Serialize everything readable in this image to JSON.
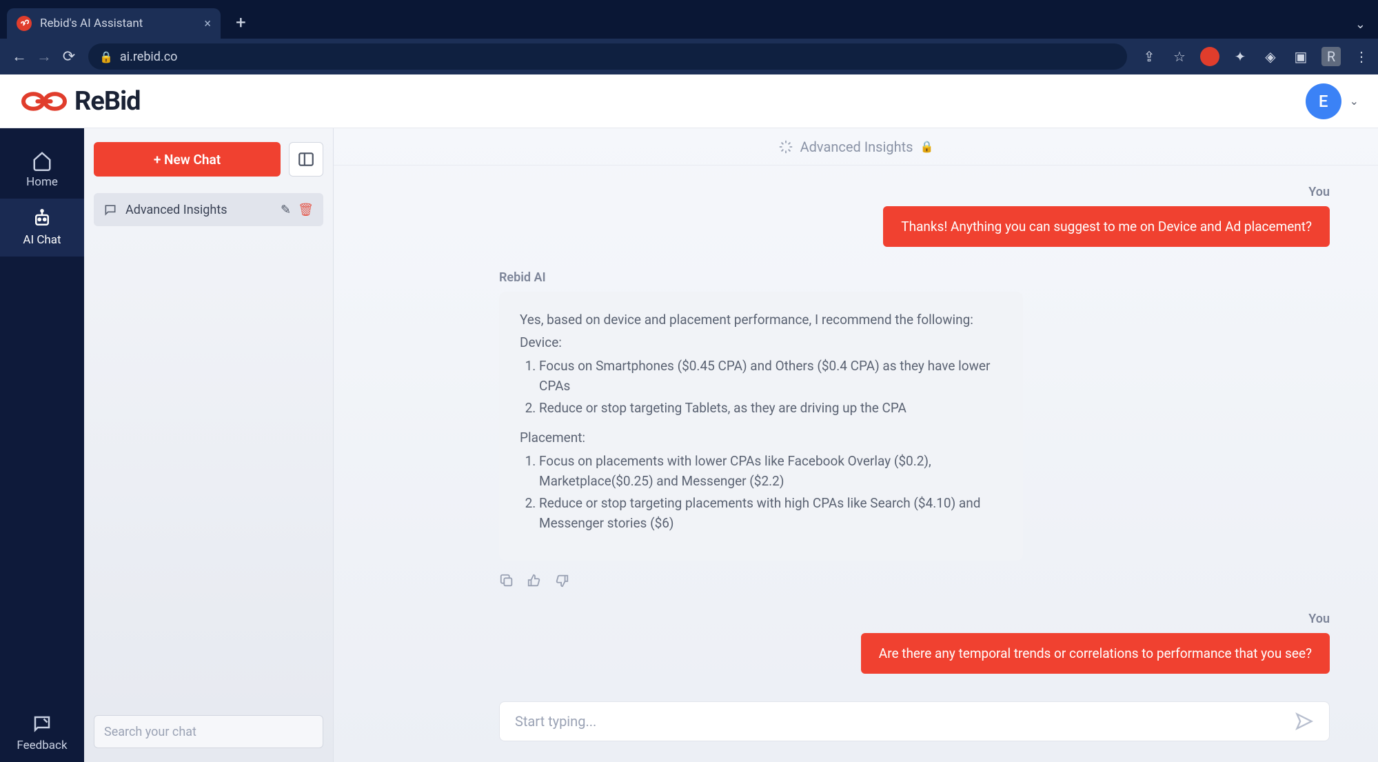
{
  "browser": {
    "tab_title": "Rebid's AI Assistant",
    "url": "ai.rebid.co",
    "profile_letter": "R"
  },
  "header": {
    "brand": "ReBid",
    "avatar_letter": "E"
  },
  "rail": {
    "home": "Home",
    "ai_chat": "AI Chat",
    "feedback": "Feedback"
  },
  "sidebar": {
    "new_chat": "+ New Chat",
    "history_item": "Advanced Insights",
    "search_placeholder": "Search your chat"
  },
  "chat": {
    "title": "Advanced Insights",
    "you_label": "You",
    "ai_label": "Rebid AI",
    "user_msg_1": "Thanks! Anything you can suggest to me on Device and Ad placement?",
    "ai_intro": "Yes, based on device and placement performance, I recommend the following:",
    "device_h": "Device:",
    "device_1": "Focus on Smartphones ($0.45 CPA) and Others ($0.4 CPA) as they have lower CPAs",
    "device_2": "Reduce or stop targeting Tablets, as they are driving up the CPA",
    "placement_h": "Placement:",
    "placement_1": "Focus on placements with lower CPAs like Facebook Overlay ($0.2), Marketplace($0.25) and Messenger ($2.2)",
    "placement_2": "Reduce or stop targeting placements with high CPAs like Search ($4.10) and Messenger stories ($6)",
    "user_msg_2": "Are there any temporal trends or correlations to performance that you see?",
    "composer_placeholder": "Start typing..."
  }
}
